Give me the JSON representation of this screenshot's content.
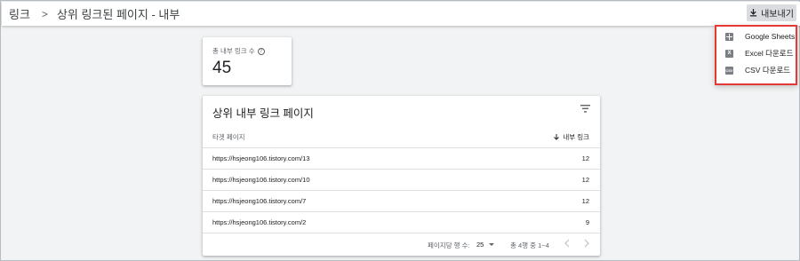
{
  "header": {
    "breadcrumb_root": "링크",
    "breadcrumb_separator": ">",
    "page_title": "상위 링크된 페이지 - 내부",
    "export_label": "내보내기"
  },
  "export_menu": {
    "items": [
      {
        "label": "Google Sheets",
        "icon": "sheets-icon"
      },
      {
        "label": "Excel 다운로드",
        "icon": "excel-icon",
        "glyph": "X"
      },
      {
        "label": "CSV 다운로드",
        "icon": "csv-icon",
        "glyph": "CSV"
      }
    ],
    "highlight_color": "#e53935"
  },
  "stat": {
    "label": "총 내부 링크 수",
    "help_glyph": "?",
    "value": "45"
  },
  "table": {
    "title": "상위 내부 링크 페이지",
    "columns": {
      "page": "타겟 페이지",
      "links": "내부 링크"
    },
    "rows": [
      {
        "url": "https://hsjeong106.tistory.com/13",
        "count": "12"
      },
      {
        "url": "https://hsjeong106.tistory.com/10",
        "count": "12"
      },
      {
        "url": "https://hsjeong106.tistory.com/7",
        "count": "12"
      },
      {
        "url": "https://hsjeong106.tistory.com/2",
        "count": "9"
      }
    ],
    "footer": {
      "rows_per_page_label": "페이지당 행 수:",
      "rows_per_page_value": "25",
      "range_label": "총 4행 중 1~4"
    }
  }
}
